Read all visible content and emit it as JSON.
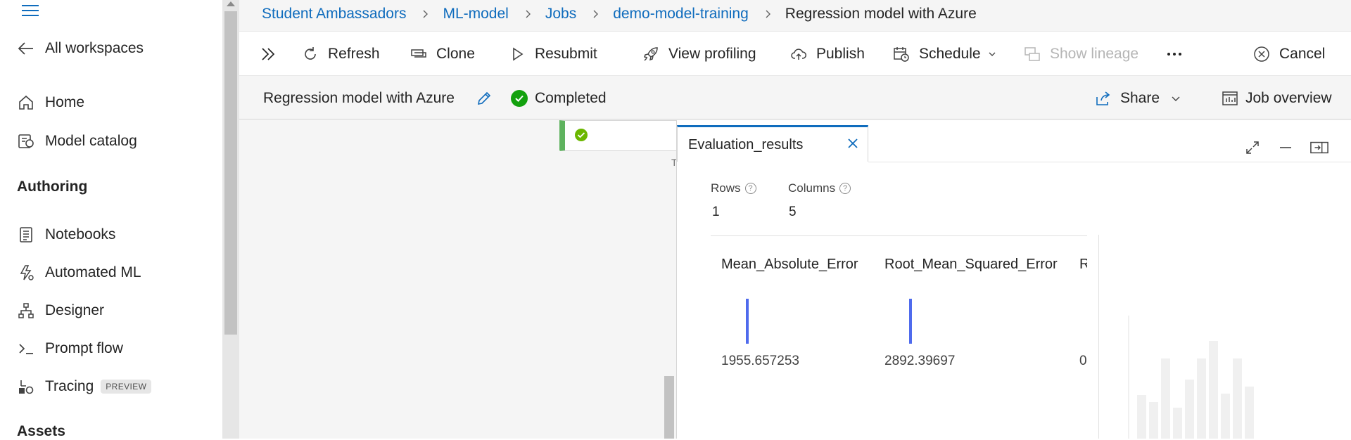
{
  "leftnav": {
    "back_label": "All workspaces",
    "items_top": [
      {
        "label": "Home",
        "icon": "home-icon"
      },
      {
        "label": "Model catalog",
        "icon": "model-catalog-icon"
      }
    ],
    "authoring_heading": "Authoring",
    "authoring_items": [
      {
        "label": "Notebooks",
        "icon": "notebook-icon"
      },
      {
        "label": "Automated ML",
        "icon": "automated-ml-icon"
      },
      {
        "label": "Designer",
        "icon": "designer-icon"
      },
      {
        "label": "Prompt flow",
        "icon": "prompt-flow-icon"
      },
      {
        "label": "Tracing",
        "icon": "tracing-icon",
        "badge": "PREVIEW"
      }
    ],
    "assets_heading": "Assets"
  },
  "breadcrumb": {
    "items": [
      "Student Ambassadors",
      "ML-model",
      "Jobs",
      "demo-model-training"
    ],
    "current": "Regression model with Azure"
  },
  "toolbar": {
    "refresh": "Refresh",
    "clone": "Clone",
    "resubmit": "Resubmit",
    "view_profiling": "View profiling",
    "publish": "Publish",
    "schedule": "Schedule",
    "show_lineage": "Show lineage",
    "cancel": "Cancel"
  },
  "job": {
    "title": "Regression model with Azure",
    "status": "Completed",
    "share": "Share",
    "overview": "Job overview"
  },
  "canvas": {
    "node_label_fragment": "T"
  },
  "panel": {
    "tab_label": "Evaluation_results",
    "rows_label": "Rows",
    "rows_value": "1",
    "columns_label": "Columns",
    "columns_value": "5",
    "columns": [
      {
        "header": "Mean_Absolute_Error",
        "value": "1955.657253"
      },
      {
        "header": "Root_Mean_Squared_Error",
        "value": "2892.39697"
      },
      {
        "header": "R",
        "value": "0"
      }
    ]
  },
  "colors": {
    "accent": "#0f6cbd",
    "success": "#13a10e",
    "bar": "#4f6bed"
  }
}
